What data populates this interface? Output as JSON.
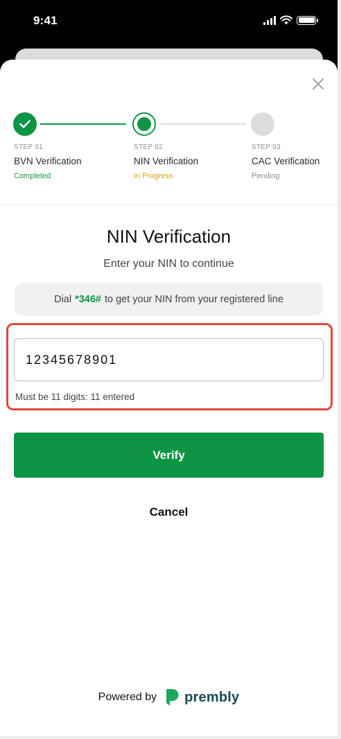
{
  "status_bar": {
    "time": "9:41"
  },
  "stepper": {
    "steps": [
      {
        "number": "STEP 01",
        "name": "BVN Verification",
        "status": "Completed",
        "state": "completed"
      },
      {
        "number": "STEP 02",
        "name": "NIN Verification",
        "status": "In Progress",
        "state": "in-progress"
      },
      {
        "number": "STEP 03",
        "name": "CAC Verification",
        "status": "Pending",
        "state": "pending"
      }
    ]
  },
  "form": {
    "title": "NIN Verification",
    "subtitle": "Enter your NIN to continue",
    "hint": {
      "prefix": "Dial",
      "code": "*346#",
      "suffix": "to get your NIN from your registered line"
    },
    "nin_value": "12345678901",
    "helper_text": "Must be 11 digits: 11 entered"
  },
  "actions": {
    "verify_label": "Verify",
    "cancel_label": "Cancel"
  },
  "footer": {
    "powered_by": "Powered by",
    "brand": "prembly"
  },
  "colors": {
    "primary": "#0d9444",
    "in_progress": "#e0a011",
    "pending": "#8e8e8e",
    "highlight": "#e0483b",
    "brand_text": "#1b4a4f"
  }
}
